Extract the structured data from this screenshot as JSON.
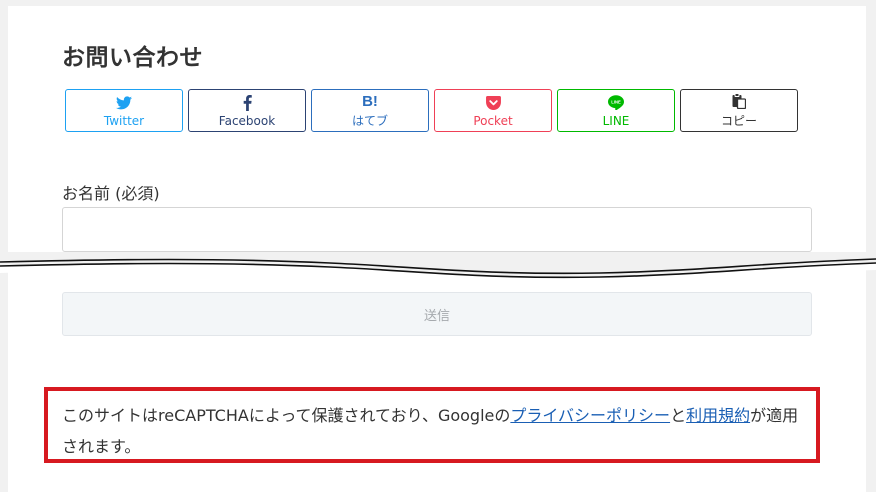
{
  "page": {
    "title": "お問い合わせ"
  },
  "share": [
    {
      "label": "Twitter",
      "icon": "twitter-bird-icon",
      "color": "#1da1f2"
    },
    {
      "label": "Facebook",
      "icon": "facebook-f-icon",
      "color": "#2c4373"
    },
    {
      "label": "はてブ",
      "icon_text": "B!",
      "icon": "hatena-bookmark-icon",
      "color": "#2c6ebd"
    },
    {
      "label": "Pocket",
      "icon": "pocket-icon",
      "color": "#ef4056"
    },
    {
      "label": "LINE",
      "icon": "line-icon",
      "color": "#00b900"
    },
    {
      "label": "コピー",
      "icon": "copy-clipboard-icon",
      "color": "#333333"
    }
  ],
  "form": {
    "name_label": "お名前 (必須)",
    "name_value": "",
    "submit_label": "送信"
  },
  "recaptcha": {
    "text_1": "このサイトはreCAPTCHAによって保護されており、Googleの",
    "privacy_link": "プライバシーポリシー",
    "text_2": "と",
    "terms_link": "利用規約",
    "text_3": "が適用されます。",
    "highlight_color": "#d71920"
  }
}
